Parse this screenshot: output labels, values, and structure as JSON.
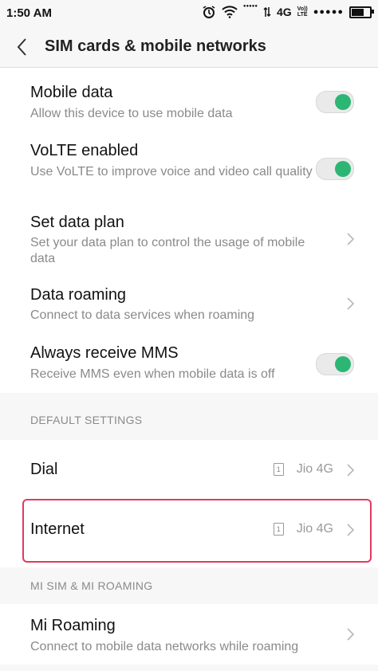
{
  "status": {
    "time": "1:50 AM",
    "network": "4G",
    "volte_line1": "Vo))",
    "volte_line2": "LTE",
    "signal_dots": "●●●●●"
  },
  "header": {
    "title": "SIM cards & mobile networks"
  },
  "mobile_section": {
    "mobile_data": {
      "label": "Mobile data",
      "sub": "Allow this device to use mobile data",
      "on": true
    },
    "volte": {
      "label": "VoLTE enabled",
      "sub": "Use VoLTE to improve voice and video call quality",
      "on": true
    },
    "data_plan": {
      "label": "Set data plan",
      "sub": "Set your data plan to control the usage of mobile data"
    },
    "roaming": {
      "label": "Data roaming",
      "sub": "Connect to data services when roaming"
    },
    "mms": {
      "label": "Always receive MMS",
      "sub": "Receive MMS even when mobile data is off",
      "on": true
    }
  },
  "default_settings": {
    "header": "DEFAULT SETTINGS",
    "dial": {
      "label": "Dial",
      "sim_slot": "1",
      "value": "Jio 4G"
    },
    "internet": {
      "label": "Internet",
      "sim_slot": "1",
      "value": "Jio 4G"
    }
  },
  "mi_section": {
    "header": "MI SIM & MI ROAMING",
    "mi_roaming": {
      "label": "Mi Roaming",
      "sub": "Connect to mobile data networks while roaming"
    }
  },
  "colors": {
    "toggle_on": "#2bb673",
    "highlight": "#e23a5e"
  }
}
